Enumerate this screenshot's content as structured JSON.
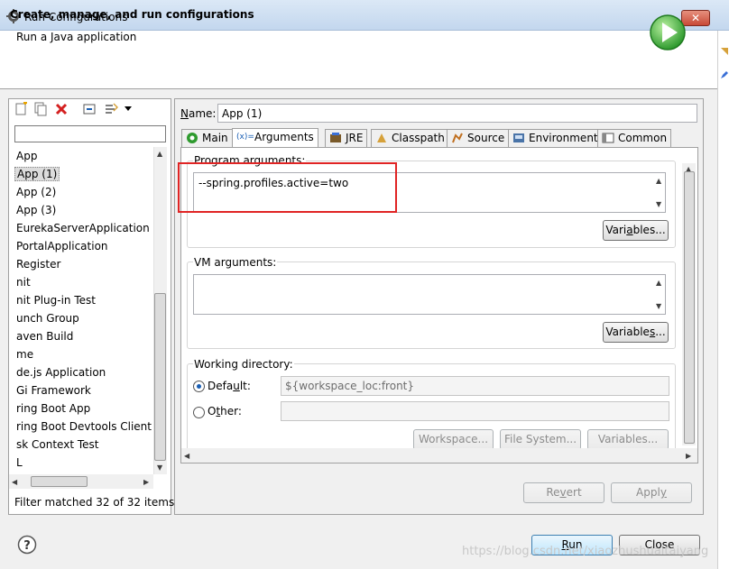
{
  "window": {
    "title": "Run Configurations",
    "close_label": "✕"
  },
  "header": {
    "title": "Create, manage, and run configurations",
    "subtitle": "Run a Java application"
  },
  "filter": {
    "value": ""
  },
  "tree": {
    "items": [
      "App",
      "App (1)",
      "App (2)",
      "App (3)",
      "EurekaServerApplication",
      "PortalApplication",
      "Register",
      "nit",
      "nit Plug-in Test",
      "unch Group",
      "aven Build",
      "me",
      "de.js Application",
      "Gi Framework",
      "ring Boot App",
      "ring Boot Devtools Client",
      "sk Context Test",
      "L"
    ],
    "selected_index": 1
  },
  "filter_status": "Filter matched 32 of 32 items",
  "name": {
    "label": "Name:",
    "value": "App (1)"
  },
  "tabs": [
    "Main",
    "Arguments",
    "JRE",
    "Classpath",
    "Source",
    "Environment",
    "Common"
  ],
  "arguments": {
    "program_label": "Program arguments:",
    "program_value": "--spring.profiles.active=two",
    "variables_label": "Variables...",
    "vm_label": "VM arguments:",
    "vm_value": "",
    "working_dir_label": "Working directory:",
    "default_label": "Default:",
    "default_value": "${workspace_loc:front}",
    "other_label": "Other:",
    "other_value": "",
    "workspace_btn": "Workspace...",
    "filesystem_btn": "File System...",
    "variables_btn": "Variables..."
  },
  "buttons": {
    "revert": "Revert",
    "apply": "Apply",
    "run": "Run",
    "close": "Close"
  },
  "watermark": "https://blog.csdn.net/xiaozhushuaitaiyang",
  "colors": {
    "highlight": "#e02424",
    "run_green": "#2e9a2e",
    "title_bar": "#c3d7ee"
  }
}
